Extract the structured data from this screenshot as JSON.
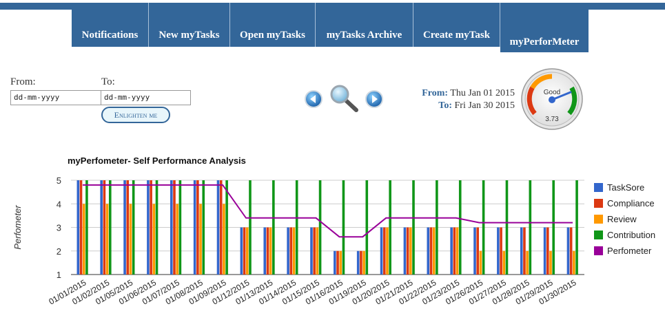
{
  "nav": {
    "tabs": [
      {
        "label": "Notifications"
      },
      {
        "label": "New myTasks"
      },
      {
        "label": "Open myTasks"
      },
      {
        "label": "myTasks Archive"
      },
      {
        "label": "Create myTask"
      },
      {
        "label": "myPerforMeter",
        "active": true
      }
    ]
  },
  "filters": {
    "from_label": "From:",
    "to_label": "To:",
    "from_value": "dd-mm-yyyy",
    "to_value": "dd-mm-yyyy",
    "submit_label": "Enlighten me"
  },
  "range": {
    "from_label": "From:",
    "from_value": "Thu Jan 01 2015",
    "to_label": "To:",
    "to_value": "Fri Jan 30 2015"
  },
  "gauge": {
    "label": "Good",
    "value": "3.73"
  },
  "icons": [
    "prev-arrow-icon",
    "magnifier-icon",
    "next-arrow-icon"
  ],
  "chart_data": {
    "type": "bar",
    "title": "myPerfometer- Self Performance Analysis",
    "ylabel": "Perfometer",
    "xlabel": "",
    "ylim": [
      1,
      5
    ],
    "yticks": [
      "1",
      "2",
      "3",
      "4",
      "5"
    ],
    "categories": [
      "01/01/2015",
      "01/02/2015",
      "01/05/2015",
      "01/06/2015",
      "01/07/2015",
      "01/08/2015",
      "01/09/2015",
      "01/12/2015",
      "01/13/2015",
      "01/14/2015",
      "01/15/2015",
      "01/16/2015",
      "01/19/2015",
      "01/20/2015",
      "01/21/2015",
      "01/22/2015",
      "01/23/2015",
      "01/26/2015",
      "01/27/2015",
      "01/28/2015",
      "01/29/2015",
      "01/30/2015"
    ],
    "series": [
      {
        "name": "TaskSore",
        "color": "#3366cc",
        "values": [
          5,
          5,
          5,
          5,
          5,
          5,
          5,
          3,
          3,
          3,
          3,
          2,
          2,
          3,
          3,
          3,
          3,
          3,
          3,
          3,
          3,
          3
        ]
      },
      {
        "name": "Compliance",
        "color": "#dc3912",
        "values": [
          5,
          5,
          5,
          5,
          5,
          5,
          5,
          3,
          3,
          3,
          3,
          2,
          2,
          3,
          3,
          3,
          3,
          3,
          3,
          3,
          3,
          3
        ]
      },
      {
        "name": "Review",
        "color": "#ff9900",
        "values": [
          4,
          4,
          4,
          4,
          4,
          4,
          4,
          3,
          3,
          3,
          3,
          2,
          2,
          3,
          3,
          3,
          3,
          2,
          2,
          2,
          2,
          2
        ]
      },
      {
        "name": "Contribution",
        "color": "#109618",
        "values": [
          5,
          5,
          5,
          5,
          5,
          5,
          5,
          5,
          5,
          5,
          5,
          5,
          5,
          5,
          5,
          5,
          5,
          5,
          5,
          5,
          5,
          5
        ]
      },
      {
        "name": "Perfometer",
        "color": "#990099",
        "type": "line",
        "values": [
          4.8,
          4.8,
          4.8,
          4.8,
          4.8,
          4.8,
          4.8,
          3.4,
          3.4,
          3.4,
          3.4,
          2.6,
          2.6,
          3.4,
          3.4,
          3.4,
          3.4,
          3.2,
          3.2,
          3.2,
          3.2,
          3.2
        ]
      }
    ],
    "grid": true,
    "legend": "right"
  }
}
